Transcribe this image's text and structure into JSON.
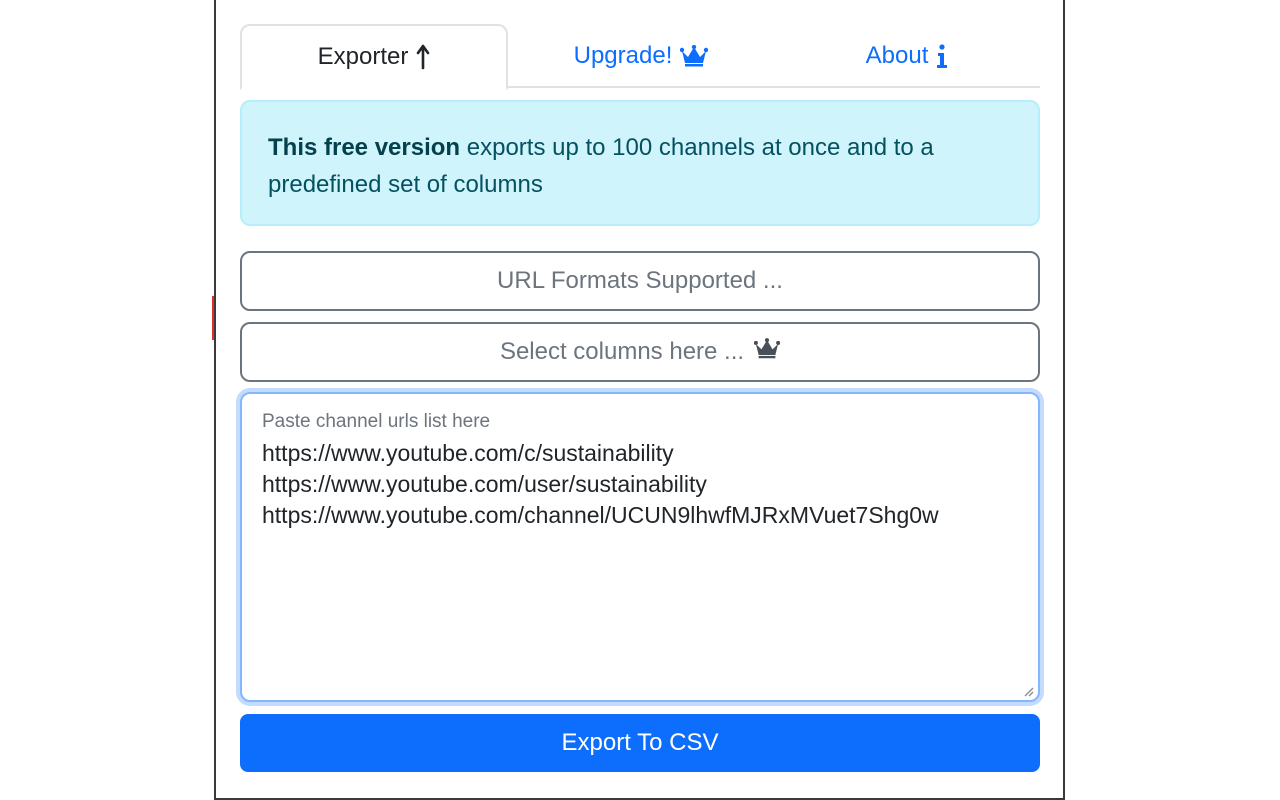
{
  "tabs": [
    {
      "label": "Exporter",
      "icon": "arrow-up-icon",
      "active": true
    },
    {
      "label": "Upgrade!",
      "icon": "crown-icon",
      "active": false
    },
    {
      "label": "About",
      "icon": "info-icon",
      "active": false
    }
  ],
  "alert": {
    "bold": "This free version",
    "text": " exports up to 100 channels at once and to a predefined set of columns"
  },
  "url_formats_button": {
    "label": "URL Formats Supported ..."
  },
  "select_columns_button": {
    "label": "Select columns here ...",
    "icon": "crown-icon"
  },
  "urls_input": {
    "placeholder": "Paste channel urls list here",
    "lines": [
      "https://www.youtube.com/c/sustainability",
      "https://www.youtube.com/user/sustainability",
      "https://www.youtube.com/channel/UCUN9lhwfMJRxMVuet7Shg0w"
    ]
  },
  "export_button": {
    "label": "Export To CSV"
  },
  "colors": {
    "primary": "#0d6efd",
    "info_bg": "#cff4fc",
    "info_text": "#055160",
    "secondary": "#6c757d"
  }
}
